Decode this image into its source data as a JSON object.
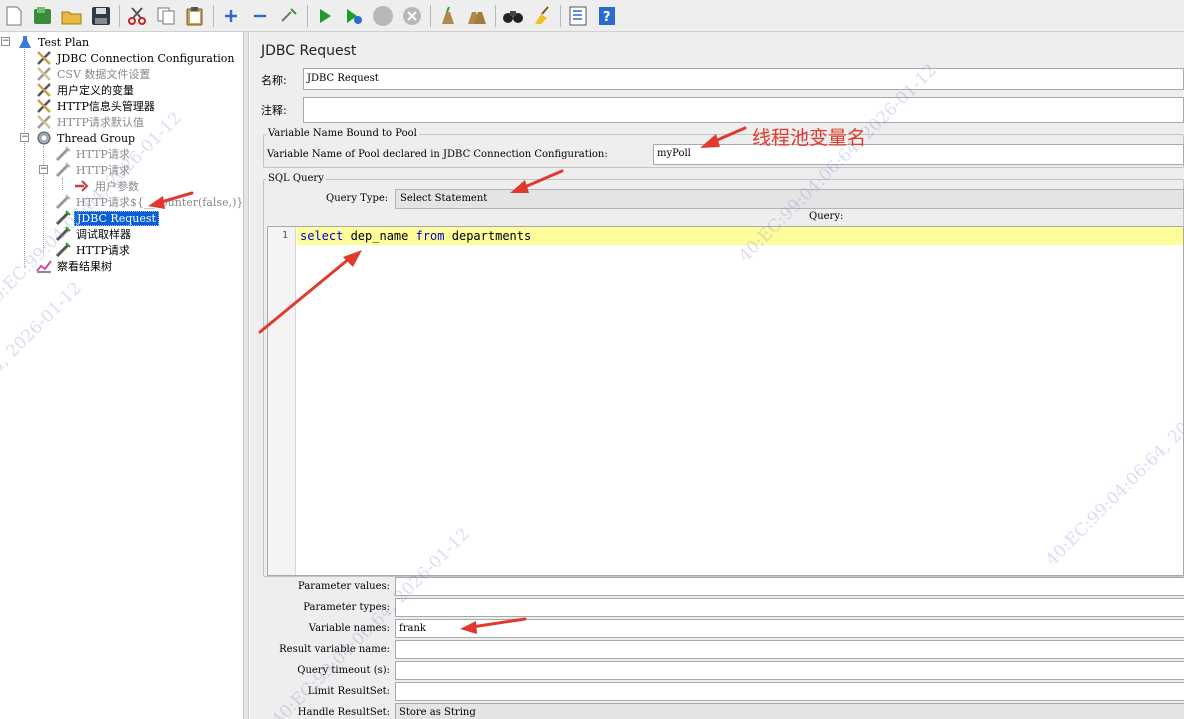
{
  "toolbar": {
    "buttons": [
      "new-icon",
      "templates-icon",
      "open-icon",
      "save-icon",
      "cut-icon",
      "copy-icon",
      "paste-icon",
      "expand-icon",
      "collapse-icon",
      "toggle-icon",
      "start-icon",
      "start-no-pause-icon",
      "stop-icon",
      "shutdown-icon",
      "clear-icon",
      "clear-all-icon",
      "search-icon",
      "reset-search-icon",
      "function-helper-icon",
      "help-icon"
    ]
  },
  "tree": {
    "items": [
      {
        "label": "Test Plan",
        "icon": "test-plan-icon"
      },
      {
        "label": "JDBC Connection Configuration",
        "icon": "config-icon"
      },
      {
        "label": "CSV 数据文件设置",
        "icon": "config-icon"
      },
      {
        "label": "用户定义的变量",
        "icon": "config-icon"
      },
      {
        "label": "HTTP信息头管理器",
        "icon": "config-icon"
      },
      {
        "label": "HTTP请求默认值",
        "icon": "config-icon"
      },
      {
        "label": "Thread Group",
        "icon": "thread-group-icon"
      },
      {
        "label": "HTTP请求",
        "icon": "sampler-icon"
      },
      {
        "label": "HTTP请求",
        "icon": "sampler-icon"
      },
      {
        "label": "用户参数",
        "icon": "preprocessor-icon"
      },
      {
        "label": "HTTP请求${__counter(false,)}",
        "icon": "sampler-icon"
      },
      {
        "label": "JDBC Request",
        "icon": "sampler-icon"
      },
      {
        "label": "调试取样器",
        "icon": "sampler-icon"
      },
      {
        "label": "HTTP请求",
        "icon": "sampler-icon"
      },
      {
        "label": "察看结果树",
        "icon": "listener-icon"
      }
    ]
  },
  "main": {
    "title": "JDBC Request",
    "name_label": "名称:",
    "name_value": "JDBC Request",
    "comment_label": "注释:",
    "comment_value": "",
    "pool_group": {
      "title": "Variable Name Bound to Pool",
      "label": "Variable Name of Pool declared in JDBC Connection Configuration:",
      "value": "myPoll"
    },
    "sql_group": {
      "title": "SQL Query",
      "query_type_label": "Query Type:",
      "query_type_value": "Select Statement",
      "query_label": "Query:",
      "line_number": "1",
      "code": {
        "kw1": "select",
        "t1": " dep_name ",
        "kw2": "from",
        "t2": " departments"
      }
    },
    "params": [
      {
        "label": "Parameter values:",
        "value": ""
      },
      {
        "label": "Parameter types:",
        "value": ""
      },
      {
        "label": "Variable names:",
        "value": "frank"
      },
      {
        "label": "Result variable name:",
        "value": ""
      },
      {
        "label": "Query timeout (s):",
        "value": ""
      },
      {
        "label": "Limit ResultSet:",
        "value": ""
      },
      {
        "label": "Handle ResultSet:",
        "value": "Store as String"
      }
    ]
  },
  "annotations": {
    "pool_note": "线程池变量名",
    "color": "#e03a2e"
  },
  "watermarks": [
    "40:EC:99:04:06:64, 2026-01-12",
    "40:EC:99:04:06:64, 2026-01-12",
    "40:EC:99:04:06:64, 2026-01-12",
    "40:EC:99:04:06:64, 2026-01-12",
    "40:EC:99:04:06:64, 2026-01-12"
  ]
}
